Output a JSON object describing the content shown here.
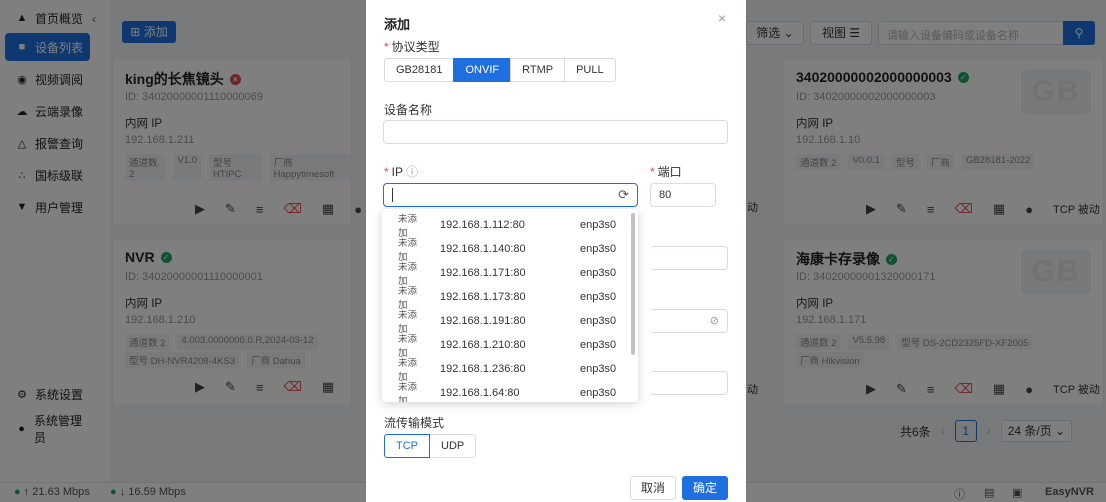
{
  "sidebar": {
    "items": [
      {
        "icon": "home-icon",
        "label": "首页概览"
      },
      {
        "icon": "device-list-icon",
        "label": "设备列表"
      },
      {
        "icon": "video-icon",
        "label": "视频调阅"
      },
      {
        "icon": "cloud-icon",
        "label": "云端录像"
      },
      {
        "icon": "alarm-icon",
        "label": "报警查询"
      },
      {
        "icon": "cascade-icon",
        "label": "国标级联"
      },
      {
        "icon": "user-icon",
        "label": "用户管理"
      }
    ],
    "bottom": [
      {
        "icon": "gear-icon",
        "label": "系统设置"
      },
      {
        "icon": "admin-icon",
        "label": "系统管理员"
      }
    ]
  },
  "header": {
    "add_label": "添加",
    "filter_label": "筛选",
    "view_label": "视图",
    "search_placeholder": "请输入设备编码或设备名称"
  },
  "cards": [
    {
      "name": "king的长焦镜头",
      "status": "offline",
      "id": "ID: 34020000001110000069",
      "ip_label": "内网 IP",
      "ip": "192.168.1.211",
      "meta": [
        "通道数 2",
        "V1.0",
        "型号 HTIPC",
        "厂商 Happytimesoft"
      ],
      "meta2": []
    },
    {
      "name": "34020000002000000003",
      "status": "online",
      "id": "ID: 34020000002000000003",
      "ip_label": "内网 IP",
      "ip": "192.168.1.10",
      "meta": [
        "通道数 2",
        "V0.0.1",
        "型号",
        "厂商",
        "GB28181-2022"
      ],
      "meta2": []
    },
    {
      "name": "NVR",
      "status": "online",
      "id": "ID: 34020000001110000001",
      "ip_label": "内网 IP",
      "ip": "192.168.1.210",
      "meta": [
        "通道数 2",
        "4.003.0000000.0.R,2024-03-12"
      ],
      "meta2": [
        "型号 DH-NVR4208-4KS3",
        "厂商 Dahua"
      ]
    },
    {
      "name": "海康卡存录像",
      "status": "online",
      "id": "ID: 34020000001320000171",
      "ip_label": "内网 IP",
      "ip": "192.168.1.171",
      "meta": [
        "通道数 2",
        "V5.5.98",
        "型号 DS-2CD2325FD-XF2005"
      ],
      "meta2": [
        "厂商 Hikvision"
      ]
    }
  ],
  "card_watermark": "GB",
  "card_action_tcp": "TCP 被动",
  "card_action_tail": "动",
  "pagination": {
    "total": "共6条",
    "page": "1",
    "page_size": "24 条/页"
  },
  "status": {
    "up": "21.63 Mbps",
    "down": "16.59 Mbps",
    "brand": "EasyNVR"
  },
  "dialog": {
    "title": "添加",
    "protocol_label": "协议类型",
    "protocols": [
      "GB28181",
      "ONVIF",
      "RTMP",
      "PULL"
    ],
    "active_protocol": "ONVIF",
    "device_name_label": "设备名称",
    "device_name_value": "",
    "ip_label": "IP",
    "ip_value": "",
    "port_label": "端口",
    "port_value": "80",
    "dropdown": [
      {
        "tag": "未添加",
        "ip": "192.168.1.112:80",
        "iface": "enp3s0"
      },
      {
        "tag": "未添加",
        "ip": "192.168.1.140:80",
        "iface": "enp3s0"
      },
      {
        "tag": "未添加",
        "ip": "192.168.1.171:80",
        "iface": "enp3s0"
      },
      {
        "tag": "未添加",
        "ip": "192.168.1.173:80",
        "iface": "enp3s0"
      },
      {
        "tag": "未添加",
        "ip": "192.168.1.191:80",
        "iface": "enp3s0"
      },
      {
        "tag": "未添加",
        "ip": "192.168.1.210:80",
        "iface": "enp3s0"
      },
      {
        "tag": "未添加",
        "ip": "192.168.1.236:80",
        "iface": "enp3s0"
      },
      {
        "tag": "未添加",
        "ip": "192.168.1.64:80",
        "iface": "enp3s0"
      }
    ],
    "stream_mode_label": "流传输模式",
    "stream_modes": [
      "TCP",
      "UDP"
    ],
    "cancel_label": "取消",
    "confirm_label": "确定"
  },
  "colors": {
    "primary": "#1f6fe0",
    "danger": "#e5484d",
    "success": "#22a560"
  }
}
